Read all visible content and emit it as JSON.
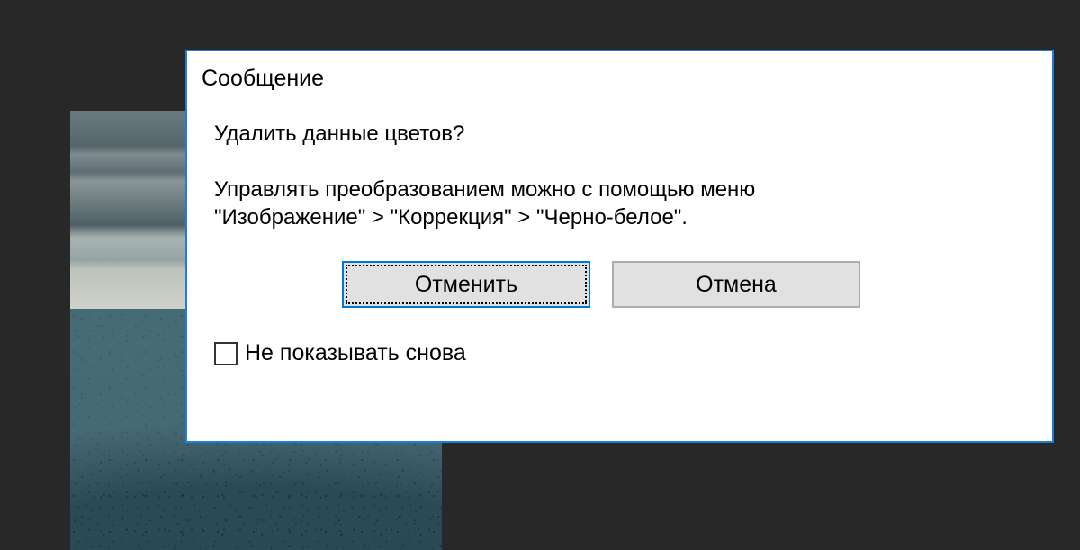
{
  "dialog": {
    "title": "Сообщение",
    "question": "Удалить данные цветов?",
    "hint_line1": "Управлять преобразованием можно с помощью меню",
    "hint_line2": "\"Изображение\" > \"Коррекция\" > \"Черно-белое\".",
    "buttons": {
      "confirm": "Отменить",
      "cancel": "Отмена"
    },
    "checkbox_label": "Не показывать снова",
    "checkbox_checked": false
  }
}
